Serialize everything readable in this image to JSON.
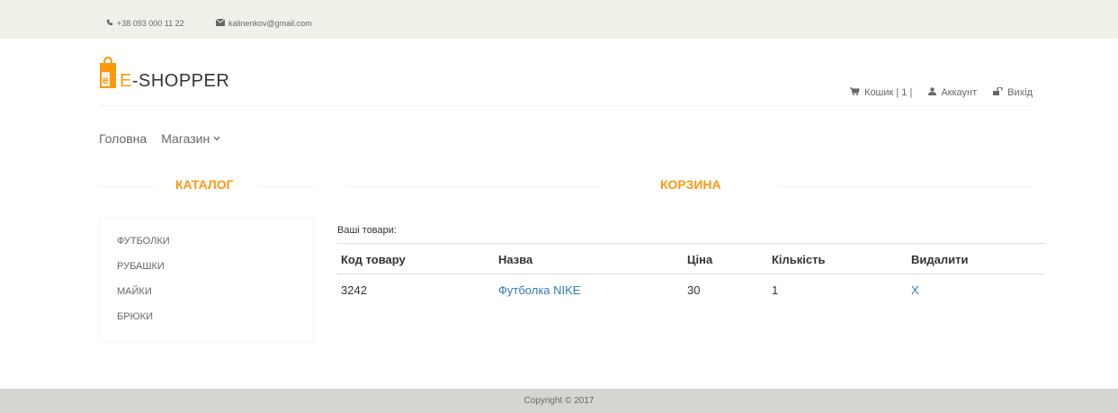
{
  "topbar": {
    "phone": "+38 093 000 11 22",
    "email": "kalinenkov@gmail.com"
  },
  "header": {
    "logo_text_prefix": "E",
    "logo_text_rest": "-SHOPPER",
    "links": {
      "cart": "Кошик | 1 |",
      "account": "Аккаунт",
      "logout": "Вихід"
    }
  },
  "nav": {
    "home": "Головна",
    "shop": "Магазин"
  },
  "catalog": {
    "title": "КАТАЛОГ",
    "items": [
      "ФУТБОЛКИ",
      "РУБАШКИ",
      "МАЙКИ",
      "БРЮКИ"
    ]
  },
  "cart": {
    "title": "КОРЗИНА",
    "intro": "Ваші товари:",
    "headers": [
      "Код товару",
      "Назва",
      "Ціна",
      "Кількість",
      "Видалити"
    ],
    "rows": [
      {
        "code": "3242",
        "name": "Футболка NIKE",
        "price": "30",
        "qty": "1",
        "remove": "X"
      }
    ]
  },
  "footer": {
    "copyright": "Copyright © 2017"
  },
  "colors": {
    "accent": "#fe980f",
    "link": "#337ab7",
    "topbar_bg": "#f0f0e9",
    "footer_bg": "#d6d6d0"
  }
}
